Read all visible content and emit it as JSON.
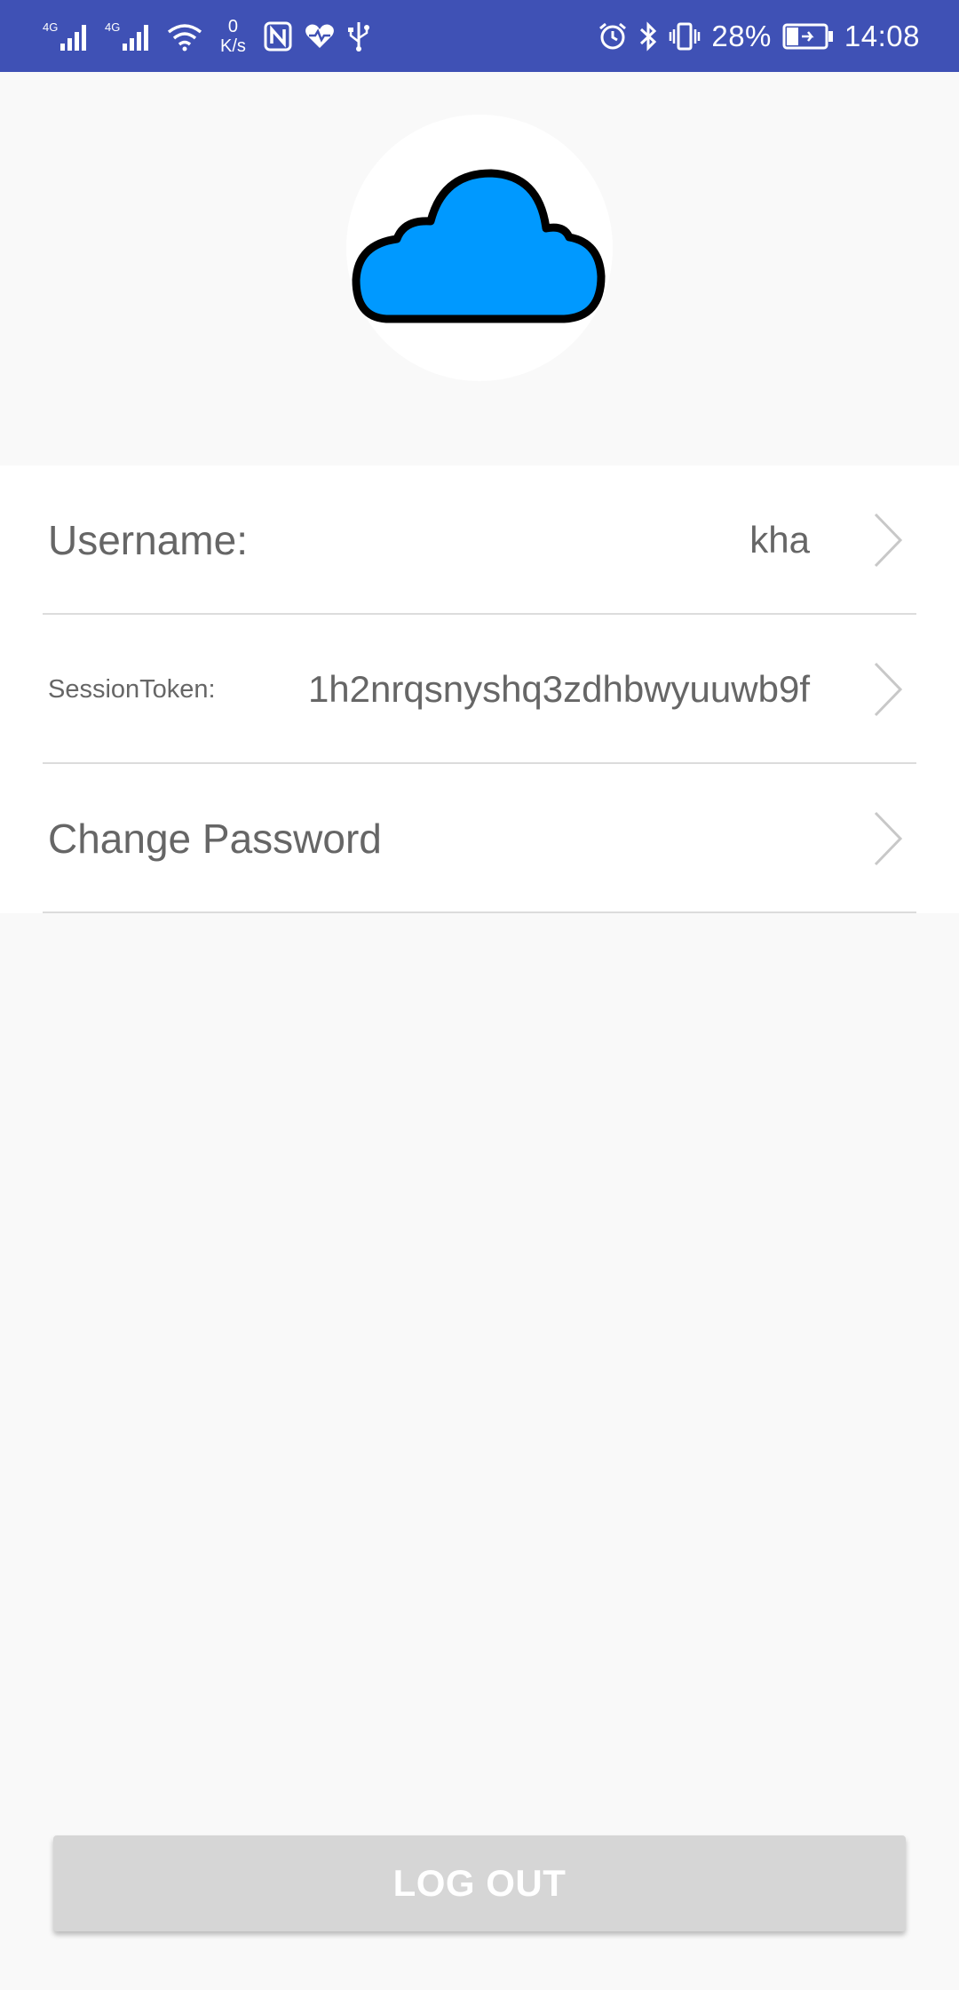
{
  "status_bar": {
    "network_1": "4G",
    "network_2": "4G",
    "speed_value": "0",
    "speed_unit": "K/s",
    "battery": "28%",
    "time": "14:08",
    "icons": [
      "signal-icon",
      "wifi-icon",
      "nfc-icon",
      "heart-icon",
      "usb-icon",
      "alarm-icon",
      "bluetooth-icon",
      "vibrate-icon",
      "battery-icon"
    ],
    "background_color": "#3f51b5"
  },
  "profile": {
    "avatar_icon": "cloud-icon",
    "avatar_color": "#0099ff"
  },
  "rows": [
    {
      "label": "Username:",
      "value": "kha"
    },
    {
      "label": "SessionToken:",
      "value": "1h2nrqsnyshq3zdhbwyuuwb9f"
    },
    {
      "label": "Change Password",
      "value": ""
    }
  ],
  "logout": {
    "label": "LOG OUT"
  }
}
